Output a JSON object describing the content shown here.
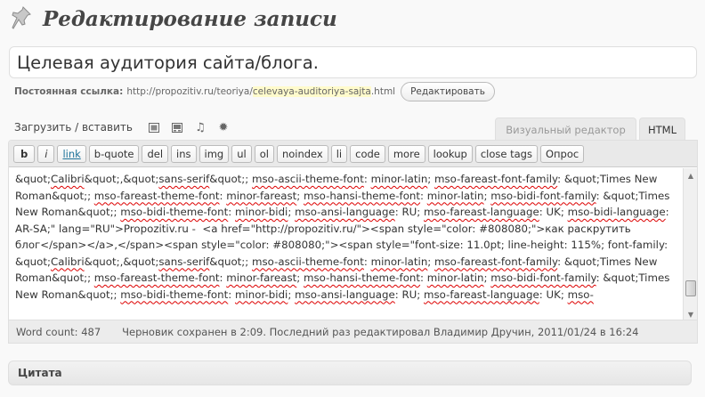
{
  "header": {
    "title": "Редактирование записи",
    "icon": "pushpin-icon"
  },
  "post": {
    "title": "Целевая аудитория сайта/блога."
  },
  "permalink": {
    "label": "Постоянная ссылка:",
    "base": "http://propozitiv.ru/teoriya/",
    "slug": "celevaya-auditoriya-sajta",
    "suffix": ".html",
    "edit_label": "Редактировать"
  },
  "media": {
    "upload_label": "Загрузить / вставить",
    "icons": [
      "image-icon",
      "video-icon",
      "audio-icon",
      "media-icon"
    ]
  },
  "tabs": {
    "visual": "Визуальный редактор",
    "html": "HTML"
  },
  "quicktags": [
    "b",
    "i",
    "link",
    "b-quote",
    "del",
    "ins",
    "img",
    "ul",
    "ol",
    "noindex",
    "li",
    "code",
    "more",
    "lookup",
    "close tags",
    "Опрос"
  ],
  "content": [
    {
      "t": "&quot;"
    },
    {
      "t": "Calibri",
      "sq": true
    },
    {
      "t": "&quot;,&quot;"
    },
    {
      "t": "sans-serif",
      "sq": true
    },
    {
      "t": "&quot;; "
    },
    {
      "t": "mso-ascii-theme-font",
      "sq": true
    },
    {
      "t": ": "
    },
    {
      "t": "minor-latin",
      "sq": true
    },
    {
      "t": "; "
    },
    {
      "t": "mso-fareast-font-family",
      "sq": true
    },
    {
      "t": ": &quot;Times New Roman&quot;; "
    },
    {
      "t": "mso-fareast-theme-font",
      "sq": true
    },
    {
      "t": ": "
    },
    {
      "t": "minor-fareast",
      "sq": true
    },
    {
      "t": "; "
    },
    {
      "t": "mso-hansi-theme-font",
      "sq": true
    },
    {
      "t": ": "
    },
    {
      "t": "minor-latin",
      "sq": true
    },
    {
      "t": "; "
    },
    {
      "t": "mso-bidi-font-family",
      "sq": true
    },
    {
      "t": ": &quot;Times New Roman&quot;; "
    },
    {
      "t": "mso-bidi-theme-font",
      "sq": true
    },
    {
      "t": ": "
    },
    {
      "t": "minor-bidi",
      "sq": true
    },
    {
      "t": "; "
    },
    {
      "t": "mso-ansi-language",
      "sq": true
    },
    {
      "t": ": RU; "
    },
    {
      "t": "mso-fareast-language",
      "sq": true
    },
    {
      "t": ": UK; "
    },
    {
      "t": "mso-bidi-language",
      "sq": true
    },
    {
      "t": ": AR-SA;\" lang=\"RU\">Propozitiv.ru -  <a href=\"http://propozitiv.ru/\"><span style=\"color: #808080;\">как раскрутить блог</span></a>,</span><span style=\"color: #808080;\"><span style=\"font-size: 11.0pt; line-height: 115%; font-family: &quot;"
    },
    {
      "t": "Calibri",
      "sq": true
    },
    {
      "t": "&quot;,&quot;"
    },
    {
      "t": "sans-serif",
      "sq": true
    },
    {
      "t": "&quot;; "
    },
    {
      "t": "mso-ascii-theme-font",
      "sq": true
    },
    {
      "t": ": "
    },
    {
      "t": "minor-latin",
      "sq": true
    },
    {
      "t": "; "
    },
    {
      "t": "mso-fareast-font-family",
      "sq": true
    },
    {
      "t": ": &quot;Times New Roman&quot;; "
    },
    {
      "t": "mso-fareast-theme-font",
      "sq": true
    },
    {
      "t": ": "
    },
    {
      "t": "minor-fareast",
      "sq": true
    },
    {
      "t": "; "
    },
    {
      "t": "mso-hansi-theme-font",
      "sq": true
    },
    {
      "t": ": "
    },
    {
      "t": "minor-latin",
      "sq": true
    },
    {
      "t": "; "
    },
    {
      "t": "mso-bidi-font-family",
      "sq": true
    },
    {
      "t": ": &quot;Times New Roman&quot;; "
    },
    {
      "t": "mso-bidi-theme-font",
      "sq": true
    },
    {
      "t": ": "
    },
    {
      "t": "minor-bidi",
      "sq": true
    },
    {
      "t": "; "
    },
    {
      "t": "mso-ansi-language",
      "sq": true
    },
    {
      "t": ": RU; "
    },
    {
      "t": "mso-fareast-language",
      "sq": true
    },
    {
      "t": ": UK; "
    },
    {
      "t": "mso-",
      "sq": true
    }
  ],
  "status": {
    "word_count": "Word count: 487",
    "saved": "Черновик сохранен в 2:09. Последний раз редактировал Владимир Дручин, 2011/01/24 в 16:24"
  },
  "excerpt_box": {
    "title": "Цитата"
  },
  "colors": {
    "slug_highlight": "#fffbcc",
    "link": "#21759b",
    "spell_error": "#dd0000"
  }
}
